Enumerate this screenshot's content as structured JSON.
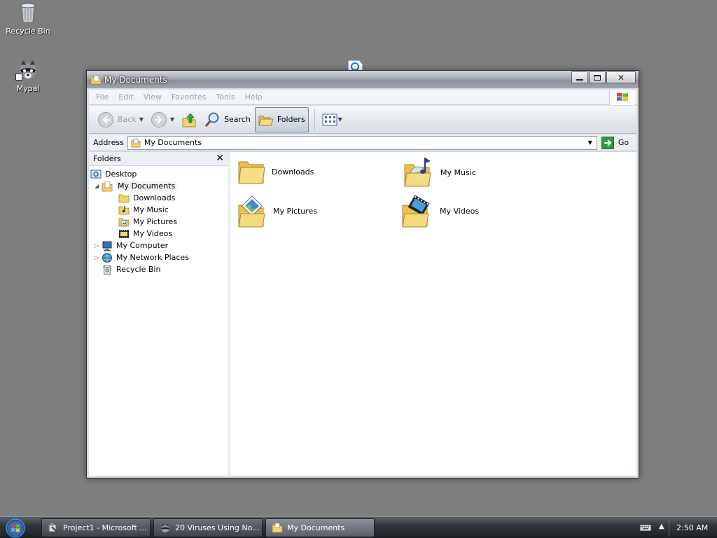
{
  "desktop": {
    "icons": [
      {
        "label": "Recycle Bin"
      },
      {
        "label": "Mypal"
      }
    ]
  },
  "window": {
    "title": "My Documents",
    "menu": [
      "File",
      "Edit",
      "View",
      "Favorites",
      "Tools",
      "Help"
    ],
    "toolbar": {
      "back": "Back",
      "search": "Search",
      "folders": "Folders"
    },
    "address": {
      "label": "Address",
      "value": "My Documents",
      "go": "Go"
    },
    "folders_pane": {
      "title": "Folders",
      "tree": [
        {
          "label": "Desktop",
          "icon": "desktop-icon",
          "level": 0
        },
        {
          "label": "My Documents",
          "icon": "my-documents-icon",
          "level": 1,
          "expanded": true,
          "selected": true
        },
        {
          "label": "Downloads",
          "icon": "folder-icon",
          "level": 2
        },
        {
          "label": "My Music",
          "icon": "music-folder-icon",
          "level": 2
        },
        {
          "label": "My Pictures",
          "icon": "pictures-folder-icon",
          "level": 2
        },
        {
          "label": "My Videos",
          "icon": "videos-folder-icon",
          "level": 2
        },
        {
          "label": "My Computer",
          "icon": "computer-icon",
          "level": 1,
          "expandable": true
        },
        {
          "label": "My Network Places",
          "icon": "network-icon",
          "level": 1,
          "expandable": true
        },
        {
          "label": "Recycle Bin",
          "icon": "recycle-bin-icon",
          "level": 1
        }
      ]
    },
    "items": [
      {
        "label": "Downloads",
        "icon": "folder-icon"
      },
      {
        "label": "My Music",
        "icon": "music-folder-icon"
      },
      {
        "label": "My Pictures",
        "icon": "pictures-folder-icon"
      },
      {
        "label": "My Videos",
        "icon": "videos-folder-icon"
      }
    ]
  },
  "taskbar": {
    "tasks": [
      {
        "label": "Project1 - Microsoft ...",
        "icon": "vb-project-icon"
      },
      {
        "label": "20 Viruses Using No...",
        "icon": "browser-icon"
      },
      {
        "label": "My Documents",
        "icon": "folder-icon",
        "active": true
      }
    ],
    "clock": "2:50 AM"
  },
  "colors": {
    "desktop_bg": "#7e7e7e",
    "folder_yellow": "#f3d36a",
    "go_green": "#2e9a3a",
    "address_border": "#7f9db9"
  }
}
